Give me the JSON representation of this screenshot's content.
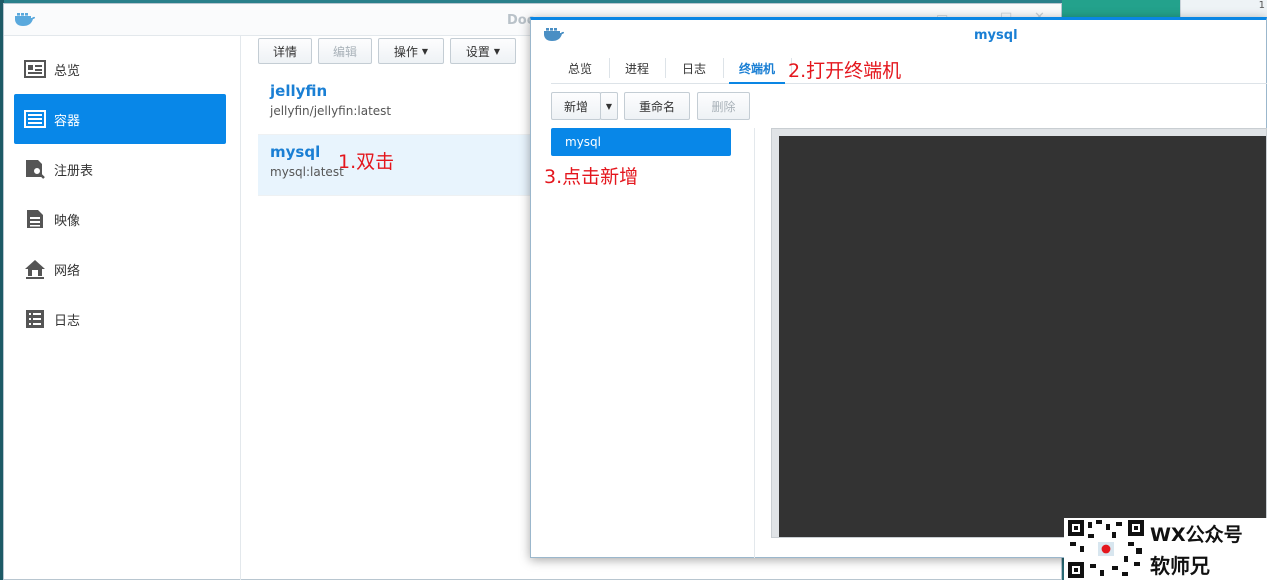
{
  "desktop": {
    "corner_number": "1"
  },
  "main_window": {
    "title": "Doc",
    "controls": {
      "minimize": "▭",
      "maximize": "□",
      "close": "✕"
    },
    "sidebar": [
      {
        "label": "总览",
        "icon": "overview-icon"
      },
      {
        "label": "容器",
        "icon": "container-icon",
        "active": true
      },
      {
        "label": "注册表",
        "icon": "registry-icon"
      },
      {
        "label": "映像",
        "icon": "image-icon"
      },
      {
        "label": "网络",
        "icon": "network-icon"
      },
      {
        "label": "日志",
        "icon": "log-icon"
      }
    ],
    "toolbar": {
      "details": "详情",
      "edit": "编辑",
      "action": "操作",
      "settings": "设置"
    },
    "containers": [
      {
        "name": "jellyfin",
        "image": "jellyfin/jellyfin:latest"
      },
      {
        "name": "mysql",
        "image": "mysql:latest",
        "selected": true
      }
    ]
  },
  "detail_window": {
    "title": "mysql",
    "tabs": [
      "总览",
      "进程",
      "日志",
      "终端机"
    ],
    "active_tab": "终端机",
    "toolbar": {
      "new": "新增",
      "rename": "重命名",
      "delete": "删除"
    },
    "terminals": [
      "mysql"
    ]
  },
  "annotations": {
    "step1": "1.双击",
    "step2": "2.打开终端机",
    "step3": "3.点击新增"
  },
  "watermark": {
    "line1": "WX公众号",
    "line2": "软师兄"
  },
  "colors": {
    "accent": "#0887e8",
    "link": "#1a7fd4",
    "annotation": "#e4161d",
    "terminal_bg": "#333333"
  }
}
